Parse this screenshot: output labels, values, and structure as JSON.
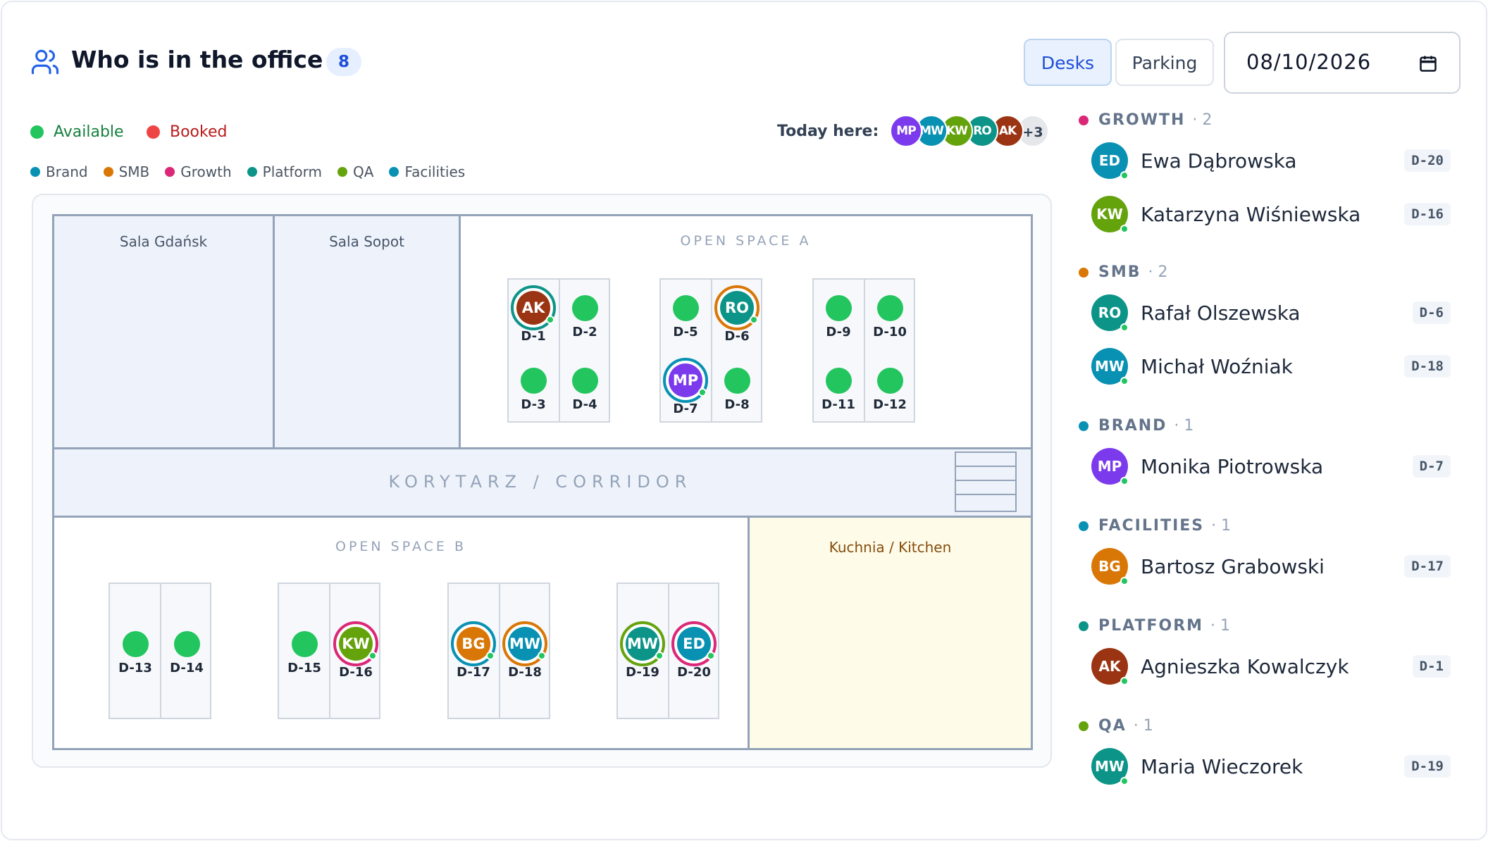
{
  "header": {
    "title": "Who is in the office",
    "count": "8",
    "tabs": {
      "desks": "Desks",
      "parking": "Parking"
    },
    "date": "08/10/2026",
    "active_tab": "desks"
  },
  "legend": {
    "available": "Available",
    "booked": "Booked",
    "available_color": "#22c55e",
    "booked_color": "#ef4444"
  },
  "teams": [
    {
      "name": "Brand",
      "color": "#0891b2"
    },
    {
      "name": "SMB",
      "color": "#d97706"
    },
    {
      "name": "Growth",
      "color": "#db2777"
    },
    {
      "name": "Platform",
      "color": "#0d9488"
    },
    {
      "name": "QA",
      "color": "#65a30d"
    },
    {
      "name": "Facilities",
      "color": "#0891b2"
    }
  ],
  "today": {
    "label": "Today here:",
    "avatars": [
      {
        "initials": "MP",
        "color": "#7c3aed"
      },
      {
        "initials": "MW",
        "color": "#0891b2"
      },
      {
        "initials": "KW",
        "color": "#65a30d"
      },
      {
        "initials": "RO",
        "color": "#0d9488"
      },
      {
        "initials": "AK",
        "color": "#9a3412"
      }
    ],
    "more": "+3"
  },
  "floor": {
    "rooms": {
      "gdansk": "Sala Gdańsk",
      "sopot": "Sala Sopot",
      "open_a": "OPEN SPACE A",
      "corridor": "KORYTARZ / CORRIDOR",
      "open_b": "OPEN SPACE B",
      "kitchen": "Kuchnia / Kitchen"
    },
    "desks": [
      {
        "id": "D-1",
        "status": "booked",
        "initials": "AK",
        "color": "#9a3412",
        "ring": "#0d9488"
      },
      {
        "id": "D-2",
        "status": "available"
      },
      {
        "id": "D-3",
        "status": "available"
      },
      {
        "id": "D-4",
        "status": "available"
      },
      {
        "id": "D-5",
        "status": "available"
      },
      {
        "id": "D-6",
        "status": "booked",
        "initials": "RO",
        "color": "#0d9488",
        "ring": "#d97706"
      },
      {
        "id": "D-7",
        "status": "booked",
        "initials": "MP",
        "color": "#7c3aed",
        "ring": "#0891b2"
      },
      {
        "id": "D-8",
        "status": "available"
      },
      {
        "id": "D-9",
        "status": "available"
      },
      {
        "id": "D-10",
        "status": "available"
      },
      {
        "id": "D-11",
        "status": "available"
      },
      {
        "id": "D-12",
        "status": "available"
      },
      {
        "id": "D-13",
        "status": "available"
      },
      {
        "id": "D-14",
        "status": "available"
      },
      {
        "id": "D-15",
        "status": "available"
      },
      {
        "id": "D-16",
        "status": "booked",
        "initials": "KW",
        "color": "#65a30d",
        "ring": "#db2777"
      },
      {
        "id": "D-17",
        "status": "booked",
        "initials": "BG",
        "color": "#d97706",
        "ring": "#0891b2"
      },
      {
        "id": "D-18",
        "status": "booked",
        "initials": "MW",
        "color": "#0891b2",
        "ring": "#d97706"
      },
      {
        "id": "D-19",
        "status": "booked",
        "initials": "MW",
        "color": "#0d9488",
        "ring": "#65a30d"
      },
      {
        "id": "D-20",
        "status": "booked",
        "initials": "ED",
        "color": "#0891b2",
        "ring": "#db2777"
      }
    ]
  },
  "sidebar": {
    "groups": [
      {
        "name": "GROWTH",
        "count": "· 2",
        "color": "#db2777",
        "people": [
          {
            "initials": "ED",
            "name": "Ewa Dąbrowska",
            "desk": "D-20",
            "color": "#0891b2"
          },
          {
            "initials": "KW",
            "name": "Katarzyna Wiśniewska",
            "desk": "D-16",
            "color": "#65a30d"
          }
        ]
      },
      {
        "name": "SMB",
        "count": "· 2",
        "color": "#d97706",
        "people": [
          {
            "initials": "RO",
            "name": "Rafał Olszewska",
            "desk": "D-6",
            "color": "#0d9488"
          },
          {
            "initials": "MW",
            "name": "Michał Woźniak",
            "desk": "D-18",
            "color": "#0891b2"
          }
        ]
      },
      {
        "name": "BRAND",
        "count": "· 1",
        "color": "#0891b2",
        "people": [
          {
            "initials": "MP",
            "name": "Monika Piotrowska",
            "desk": "D-7",
            "color": "#7c3aed"
          }
        ]
      },
      {
        "name": "FACILITIES",
        "count": "· 1",
        "color": "#0891b2",
        "people": [
          {
            "initials": "BG",
            "name": "Bartosz Grabowski",
            "desk": "D-17",
            "color": "#d97706"
          }
        ]
      },
      {
        "name": "PLATFORM",
        "count": "· 1",
        "color": "#0d9488",
        "people": [
          {
            "initials": "AK",
            "name": "Agnieszka Kowalczyk",
            "desk": "D-1",
            "color": "#9a3412"
          }
        ]
      },
      {
        "name": "QA",
        "count": "· 1",
        "color": "#65a30d",
        "people": [
          {
            "initials": "MW",
            "name": "Maria Wieczorek",
            "desk": "D-19",
            "color": "#0d9488"
          }
        ]
      }
    ]
  }
}
